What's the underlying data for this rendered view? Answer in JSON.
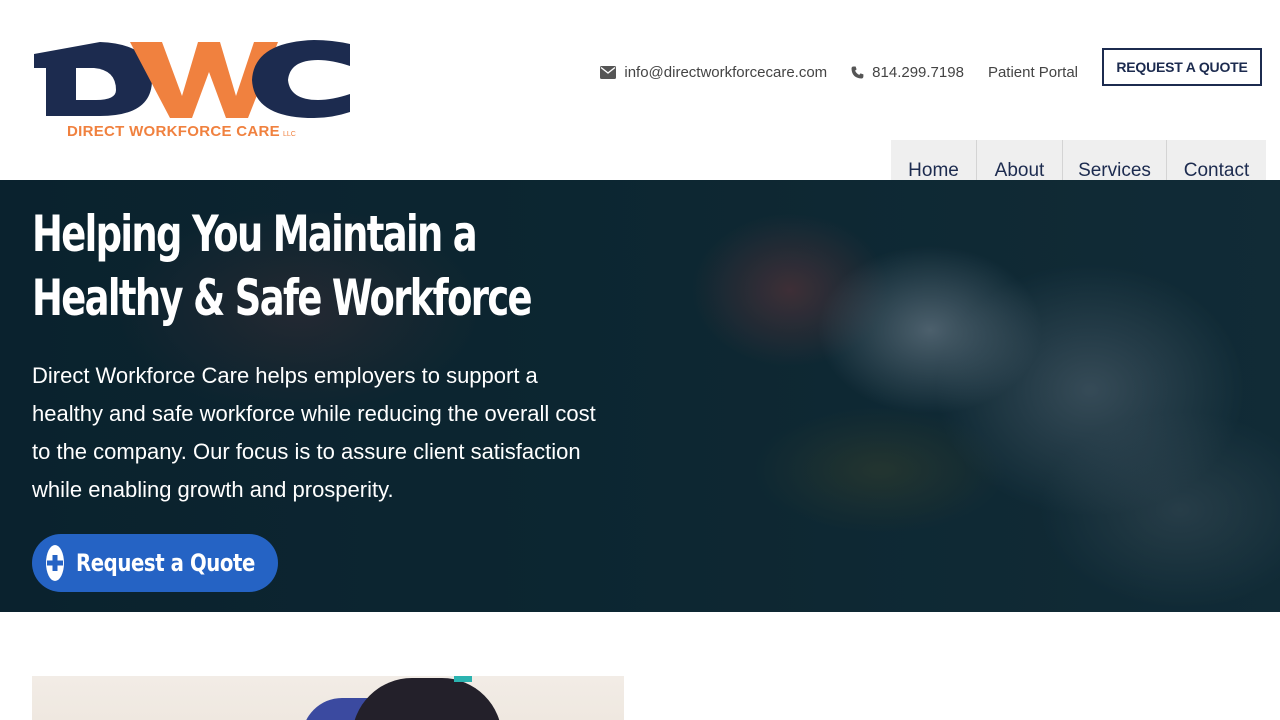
{
  "header": {
    "logo": {
      "initials": "DWC",
      "name": "DIRECT WORKFORCE CARE",
      "suffix": "LLC"
    },
    "email": "info@directworkforcecare.com",
    "phone": "814.299.7198",
    "portal_label": "Patient Portal",
    "quote_button": "REQUEST A QUOTE"
  },
  "nav": {
    "items": [
      {
        "label": "Home",
        "active": true
      },
      {
        "label": "About",
        "active": false
      },
      {
        "label": "Services",
        "active": false
      },
      {
        "label": "Contact",
        "active": false
      }
    ]
  },
  "hero": {
    "title_line1": "Helping You Maintain a",
    "title_line2": "Healthy & Safe Workforce",
    "description": "Direct Workforce Care helps employers to support a healthy and safe workforce while reducing the overall cost to the company. Our focus is to assure client satisfaction while enabling growth and prosperity.",
    "cta_label": "Request a Quote",
    "cta_icon": "plus-circle-icon"
  },
  "colors": {
    "navy": "#1c2b4f",
    "orange": "#f0813f",
    "blue": "#2563c4",
    "nav_bg": "#efefef"
  },
  "icons": {
    "email": "envelope-icon",
    "phone": "phone-icon"
  }
}
